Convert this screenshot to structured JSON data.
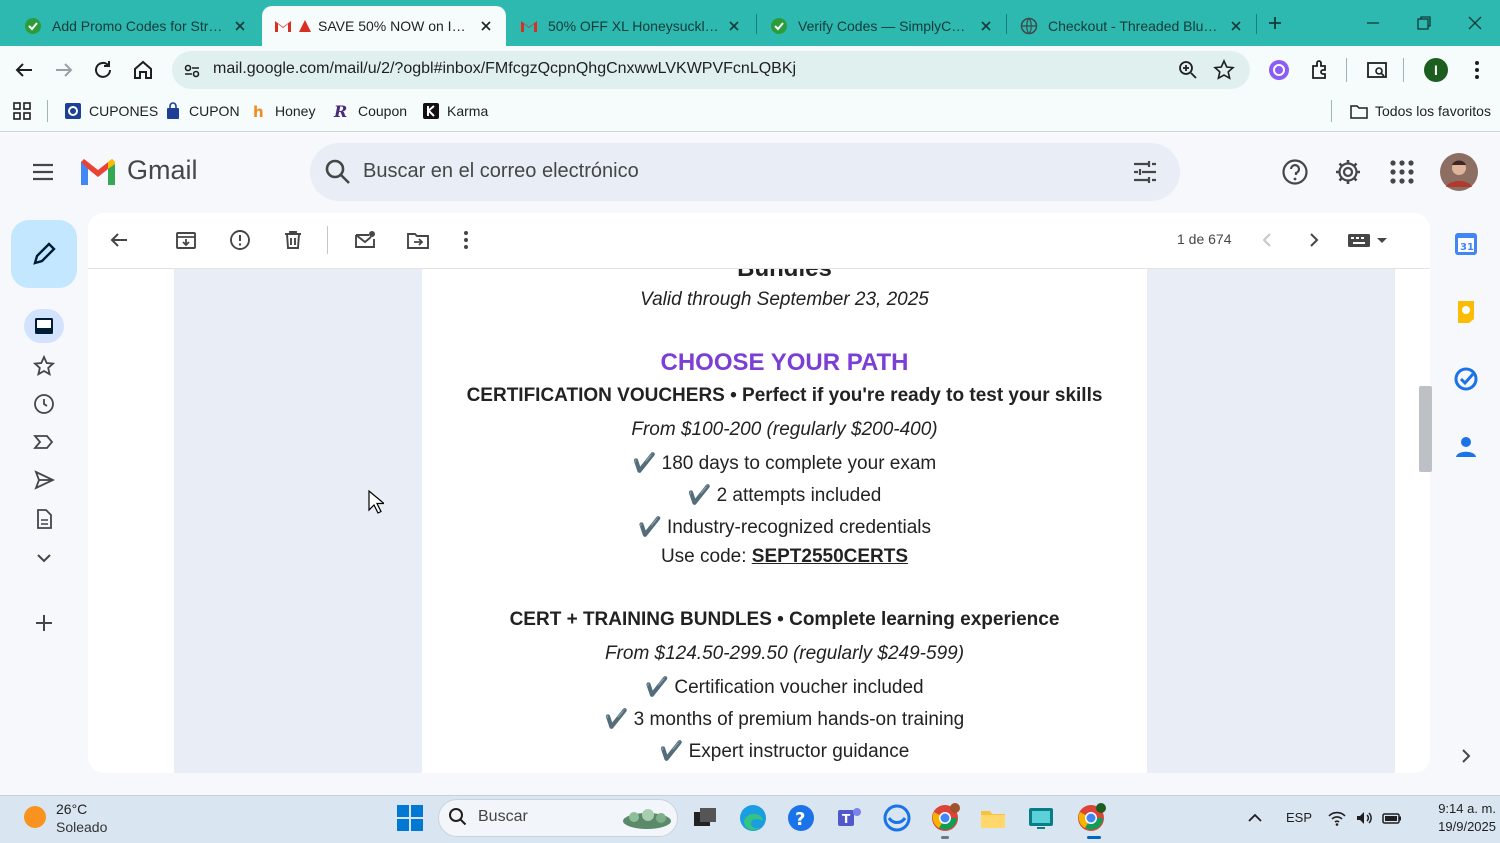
{
  "browser": {
    "tabs": [
      {
        "title": "Add Promo Codes for Strong",
        "active": false
      },
      {
        "title": "SAVE 50% NOW on INE S",
        "active": true
      },
      {
        "title": "50% OFF XL Honeysuckle Pe",
        "active": false
      },
      {
        "title": "Verify Codes — SimplyCodes",
        "active": false
      },
      {
        "title": "Checkout - Threaded Blue Bo",
        "active": false
      }
    ],
    "url": "mail.google.com/mail/u/2/?ogbl#inbox/FMfcgzQcpnQhgCnxwwLVKWPVFcnLQBKj",
    "bookmarks": [
      "CUPONES",
      "CUPON",
      "Honey",
      "Coupon",
      "Karma"
    ],
    "all_bookmarks_label": "Todos los favoritos",
    "profile_initial": "I"
  },
  "gmail": {
    "logo_text": "Gmail",
    "search_placeholder": "Buscar en el correo electrónico",
    "page_count": "1 de 674"
  },
  "email": {
    "partial_heading": "Bundles",
    "valid_through": "Valid through September 23, 2025",
    "section_title": "CHOOSE YOUR PATH",
    "cert_heading": "CERTIFICATION VOUCHERS • Perfect if you're ready to test your skills",
    "cert_price": "From $100-200 (regularly $200-400)",
    "cert_features": [
      "✔️ 180 days to complete your exam",
      "✔️ 2 attempts included",
      "✔️ Industry-recognized credentials"
    ],
    "use_code_label": "Use code:",
    "cert_code": "SEPT2550CERTS",
    "bundle_heading": "CERT + TRAINING BUNDLES • Complete learning experience",
    "bundle_price": "From $124.50-299.50 (regularly $249-599)",
    "bundle_features": [
      "✔️ Certification voucher included",
      "✔️ 3 months of premium hands-on training",
      "✔️ Expert instructor guidance"
    ]
  },
  "taskbar": {
    "weather_temp": "26°C",
    "weather_desc": "Soleado",
    "search_label": "Buscar",
    "language": "ESP",
    "time": "9:14 a. m.",
    "date": "19/9/2025"
  },
  "colors": {
    "tabbar": "#2db9b0",
    "toolbar": "#f6fcfc",
    "section_title": "#7b3fd6",
    "gmail_bg": "#f6f8fc"
  }
}
